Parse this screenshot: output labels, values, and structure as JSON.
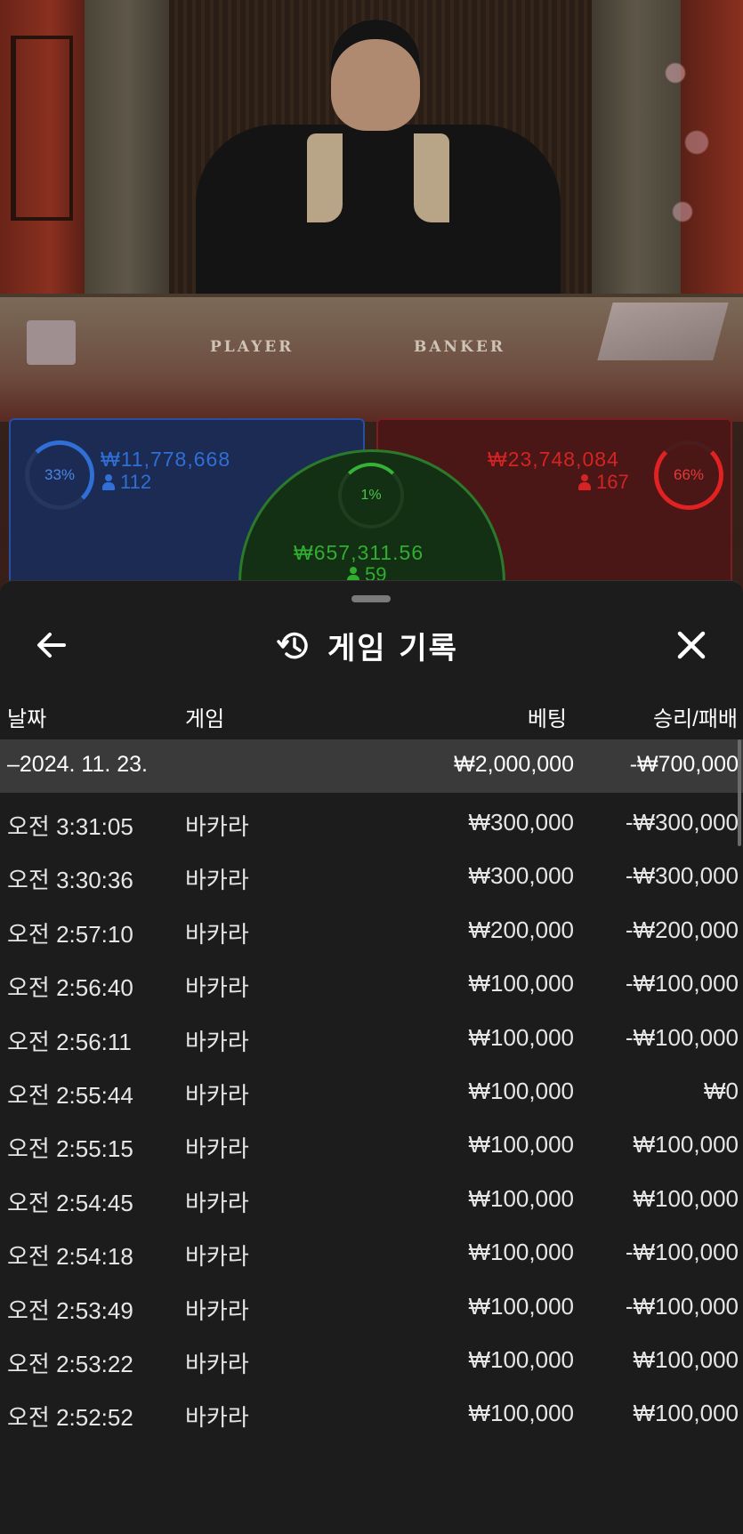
{
  "stream": {
    "table_labels": {
      "player": "PLAYER",
      "banker": "BANKER"
    }
  },
  "bets": {
    "player": {
      "percent": "33%",
      "amount": "₩11,778,668",
      "players": "112",
      "color": "#2f6fd6"
    },
    "tie": {
      "percent": "1%",
      "amount": "₩657,311.56",
      "players": "59",
      "color": "#36b336"
    },
    "banker": {
      "percent": "66%",
      "amount": "₩23,748,084",
      "players": "167",
      "color": "#e02222"
    }
  },
  "sheet": {
    "title": "게임 기록",
    "icons": {
      "back": "arrow-left-icon",
      "history": "history-icon",
      "close": "close-icon"
    },
    "columns": {
      "date": "날짜",
      "game": "게임",
      "bet": "베팅",
      "result": "승리/패배"
    },
    "summary": {
      "date": "–2024. 11. 23.",
      "bet": "₩2,000,000",
      "result": "-₩700,000"
    },
    "rows": [
      {
        "time": "오전 3:31:05",
        "game": "바카라",
        "bet": "₩300,000",
        "result": "-₩300,000"
      },
      {
        "time": "오전 3:30:36",
        "game": "바카라",
        "bet": "₩300,000",
        "result": "-₩300,000"
      },
      {
        "time": "오전 2:57:10",
        "game": "바카라",
        "bet": "₩200,000",
        "result": "-₩200,000"
      },
      {
        "time": "오전 2:56:40",
        "game": "바카라",
        "bet": "₩100,000",
        "result": "-₩100,000"
      },
      {
        "time": "오전 2:56:11",
        "game": "바카라",
        "bet": "₩100,000",
        "result": "-₩100,000"
      },
      {
        "time": "오전 2:55:44",
        "game": "바카라",
        "bet": "₩100,000",
        "result": "₩0"
      },
      {
        "time": "오전 2:55:15",
        "game": "바카라",
        "bet": "₩100,000",
        "result": "₩100,000"
      },
      {
        "time": "오전 2:54:45",
        "game": "바카라",
        "bet": "₩100,000",
        "result": "₩100,000"
      },
      {
        "time": "오전 2:54:18",
        "game": "바카라",
        "bet": "₩100,000",
        "result": "-₩100,000"
      },
      {
        "time": "오전 2:53:49",
        "game": "바카라",
        "bet": "₩100,000",
        "result": "-₩100,000"
      },
      {
        "time": "오전 2:53:22",
        "game": "바카라",
        "bet": "₩100,000",
        "result": "₩100,000"
      },
      {
        "time": "오전 2:52:52",
        "game": "바카라",
        "bet": "₩100,000",
        "result": "₩100,000"
      }
    ]
  }
}
